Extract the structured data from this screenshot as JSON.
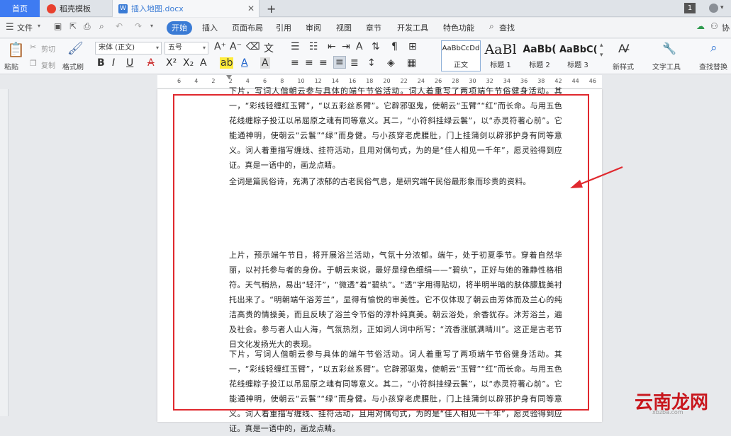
{
  "tabs": {
    "home": "首页",
    "template": "稻壳模板",
    "document": "插入地图.docx",
    "add": "+",
    "badge": "1"
  },
  "menu": {
    "file": "文件",
    "start": "开始",
    "items": [
      "插入",
      "页面布局",
      "引用",
      "审阅",
      "视图",
      "章节",
      "开发工具",
      "特色功能"
    ],
    "search": "查找",
    "collab": "协"
  },
  "ribbon": {
    "paste": "粘贴",
    "cut": "剪切",
    "copy": "复制",
    "format_painter": "格式刷",
    "font_name": "宋体 (正文)",
    "font_size": "五号",
    "styles": [
      {
        "sample": "AaBbCcDd",
        "name": "正文"
      },
      {
        "sample": "AaBl",
        "name": "标题 1"
      },
      {
        "sample": "AaBb(",
        "name": "标题 2"
      },
      {
        "sample": "AaBbC(",
        "name": "标题 3"
      }
    ],
    "new_style": "新样式",
    "text_tools": "文字工具",
    "find_replace": "查找替换"
  },
  "ruler_ticks": [
    "6",
    "4",
    "2",
    "2",
    "4",
    "6",
    "8",
    "10",
    "12",
    "14",
    "16",
    "18",
    "20",
    "22",
    "24",
    "26",
    "28",
    "30",
    "32",
    "34",
    "36",
    "38",
    "42",
    "44",
    "46"
  ],
  "document": {
    "p1": "下片，写词人偕朝云参与具体的端午节俗活动。词人着重写了两项端午节俗健身活动。其一，“彩线轻缠红玉臂”，“以五彩丝系臂”。它辟邪驱鬼，使朝云“玉臂”“红”而长命。与用五色花线缠粽子投江以吊屈原之魂有同等意义。其二，“小符斜挂绿云鬟”，以“赤灵符著心前”。它能通神明，使朝云“云鬟”“绿”而身健。与小孩穿老虎腰肚，门上挂蒲剑以辟邪护身有同等意义。词人着重描写缠线、挂符活动，且用对偶句式，为的是“佳人相见一千年”，愿灵验得到应证。真是一语中的，画龙点睛。",
    "p2": "全词是篇民俗诗，充满了浓郁的古老民俗气息，是研究端午民俗最形象而珍贵的资料。",
    "p3": "上片，预示端午节日，将开展浴兰活动，气氛十分浓郁。端午，处于初夏季节。穿着自然华丽，以衬托参与者的身份。于朝云来说，最好是绿色细绢——“碧纨”，正好与她的雅静性格相符。天气稍热，易出“轻汗”，“微透”着“碧纨”。“透”字用得贴切，将半明半暗的肤体朦胧美衬托出来了。“明朝端午浴芳兰”，显得有愉悦的审美性。它不仅体现了朝云由芳体而及兰心的纯洁高贵的情操美，而且反映了浴兰令节俗的淳朴纯真美。朝云浴处，余香犹存。沐芳浴兰，遍及社会。参与者人山人海，气氛热烈，正如词人词中所写：“流香涨腻满晴川”。这正是古老节日文化发扬光大的表现。",
    "p4": "下片，写词人偕朝云参与具体的端午节俗活动。词人着重写了两项端午节俗健身活动。其一，“彩线轻缠红玉臂”，“以五彩丝系臂”。它辟邪驱鬼，使朝云“玉臂”“红”而长命。与用五色花线缠粽子投江以吊屈原之魂有同等意义。其二，“小符斜挂绿云鬟”，以“赤灵符著心前”。它能通神明，使朝云“云鬟”“绿”而身健。与小孩穿老虎腰肚，门上挂蒲剑以辟邪护身有同等意义。词人着重描写缠线、挂符活动，且用对偶句式，为的是“佳人相见一千年”，愿灵验得到应证。真是一语中的，画龙点睛。"
  },
  "watermark": {
    "text": "云南龙网",
    "sub": "xbzba.com"
  },
  "colors": {
    "accent": "#3e7bf2",
    "annotation": "#e0282e"
  }
}
